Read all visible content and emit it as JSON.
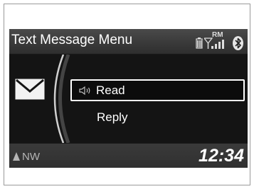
{
  "header": {
    "title": "Text Message Menu",
    "roaming_label": "RM"
  },
  "status_icons": [
    "phone-battery-icon",
    "signal-strength-icon",
    "bluetooth-icon"
  ],
  "message_icon": "envelope-icon",
  "menu": {
    "items": [
      {
        "label": "Read",
        "icon": "speaker-icon",
        "selected": true
      },
      {
        "label": "Reply",
        "selected": false
      }
    ]
  },
  "footer": {
    "compass": "NW",
    "clock": "12:34"
  },
  "colors": {
    "screen_bg": "#151515",
    "header_bg": "#404040",
    "text": "#ffffff",
    "compass_text": "#b5b5b5"
  }
}
